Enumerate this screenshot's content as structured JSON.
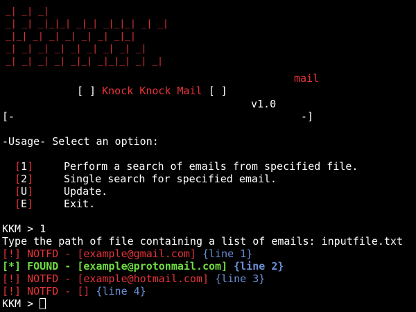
{
  "banner": {
    "art": [
      " _|        _|                                   _|",
      " _|    _|      _|_|_|      _|_|      _|_|_|    _|    _|",
      " _|_|          _|    _|  _|    _|  _|          _|_|",
      " _|    _|      _|    _|  _|    _|  _|          _|    _|",
      " _|      _|    _|    _|    _|_|      _|_|_|    _|      _|"
    ],
    "subword": "mail",
    "color": "#e8333a"
  },
  "header": {
    "bracket_left": "[ ] ",
    "title": "Knock Knock Mail",
    "bracket_right": " [ ]",
    "version": "v1.0",
    "border_left": "[-",
    "border_right": "-]"
  },
  "usage": {
    "heading": "-Usage- Select an option:",
    "options": [
      {
        "key": "1",
        "label": "Perform a search of emails from specified file."
      },
      {
        "key": "2",
        "label": "Single search for specified email."
      },
      {
        "key": "U",
        "label": "Update."
      },
      {
        "key": "E",
        "label": "Exit."
      }
    ]
  },
  "session": {
    "prompt": "KKM > ",
    "input_1": "1",
    "question": "Type the path of file containing a list of emails: inputfile.txt",
    "results": [
      {
        "tag": "[!]",
        "status": "NOTFD",
        "email": "[example@gmail.com]",
        "line": "{line 1}",
        "found": false
      },
      {
        "tag": "[*]",
        "status": "FOUND",
        "email": "[example@protonmail.com]",
        "line": "{line 2}",
        "found": true
      },
      {
        "tag": "[!]",
        "status": "NOTFD",
        "email": "[example@hotmail.com]",
        "line": "{line 3}",
        "found": false
      },
      {
        "tag": "[!]",
        "status": "NOTFD",
        "email": "[]",
        "line": "{line 4}",
        "found": false
      }
    ]
  },
  "colors": {
    "background": "#000000",
    "text": "#ffffff",
    "error": "#e8333a",
    "success": "#6fdc41",
    "info": "#6b8fd6"
  }
}
